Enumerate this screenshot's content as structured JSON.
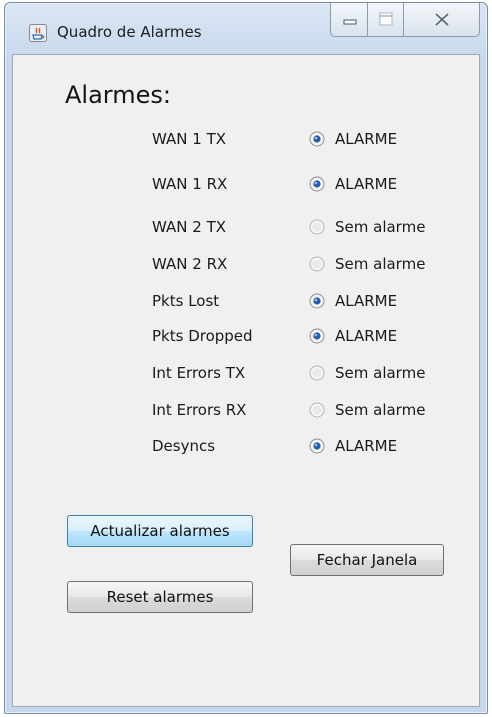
{
  "window": {
    "title": "Quadro de Alarmes"
  },
  "heading": "Alarmes:",
  "alarms": [
    {
      "label": "WAN 1 TX",
      "status": "ALARME",
      "selected": true
    },
    {
      "label": "WAN 1 RX",
      "status": "ALARME",
      "selected": true
    },
    {
      "label": "WAN 2 TX",
      "status": "Sem alarme",
      "selected": false
    },
    {
      "label": "WAN 2 RX",
      "status": "Sem alarme",
      "selected": false
    },
    {
      "label": "Pkts Lost",
      "status": "ALARME",
      "selected": true
    },
    {
      "label": "Pkts Dropped",
      "status": "ALARME",
      "selected": true
    },
    {
      "label": "Int Errors TX",
      "status": "Sem alarme",
      "selected": false
    },
    {
      "label": "Int Errors RX",
      "status": "Sem alarme",
      "selected": false
    },
    {
      "label": "Desyncs",
      "status": "ALARME",
      "selected": true
    }
  ],
  "buttons": {
    "update": "Actualizar alarmes",
    "close": "Fechar Janela",
    "reset": "Reset alarmes"
  },
  "colors": {
    "radio_selected": "#1f5fa8",
    "update_button_focus": "#bee6fd"
  }
}
